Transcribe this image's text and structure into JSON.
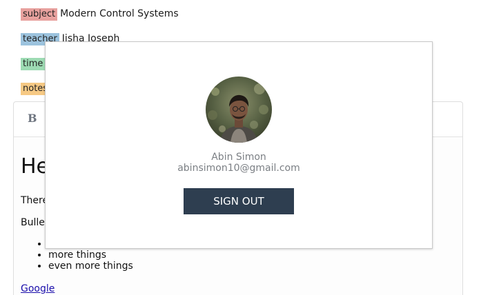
{
  "meta": {
    "subject": {
      "label": "subject",
      "value": "Modern Control Systems"
    },
    "teacher": {
      "label": "teacher",
      "value": "Jisha Joseph"
    },
    "time": {
      "label": "time",
      "value": ""
    },
    "notes": {
      "label": "notes",
      "value": ""
    }
  },
  "editor": {
    "toolbar": {
      "bold_label": "B"
    },
    "heading": "He",
    "paragraph_1": "There",
    "paragraph_2": "Bullet",
    "list_items": [
      "more things",
      "even more things"
    ],
    "link_text": "Google"
  },
  "account_popup": {
    "name": "Abin Simon",
    "email": "abinsimon10@gmail.com",
    "signout_label": "SIGN OUT",
    "signout_color": "#2e3e50"
  },
  "colors": {
    "subject_tag": "#e8a19e",
    "teacher_tag": "#9cc3de",
    "time_tag": "#9ddbb3",
    "notes_tag": "#f6c984"
  }
}
